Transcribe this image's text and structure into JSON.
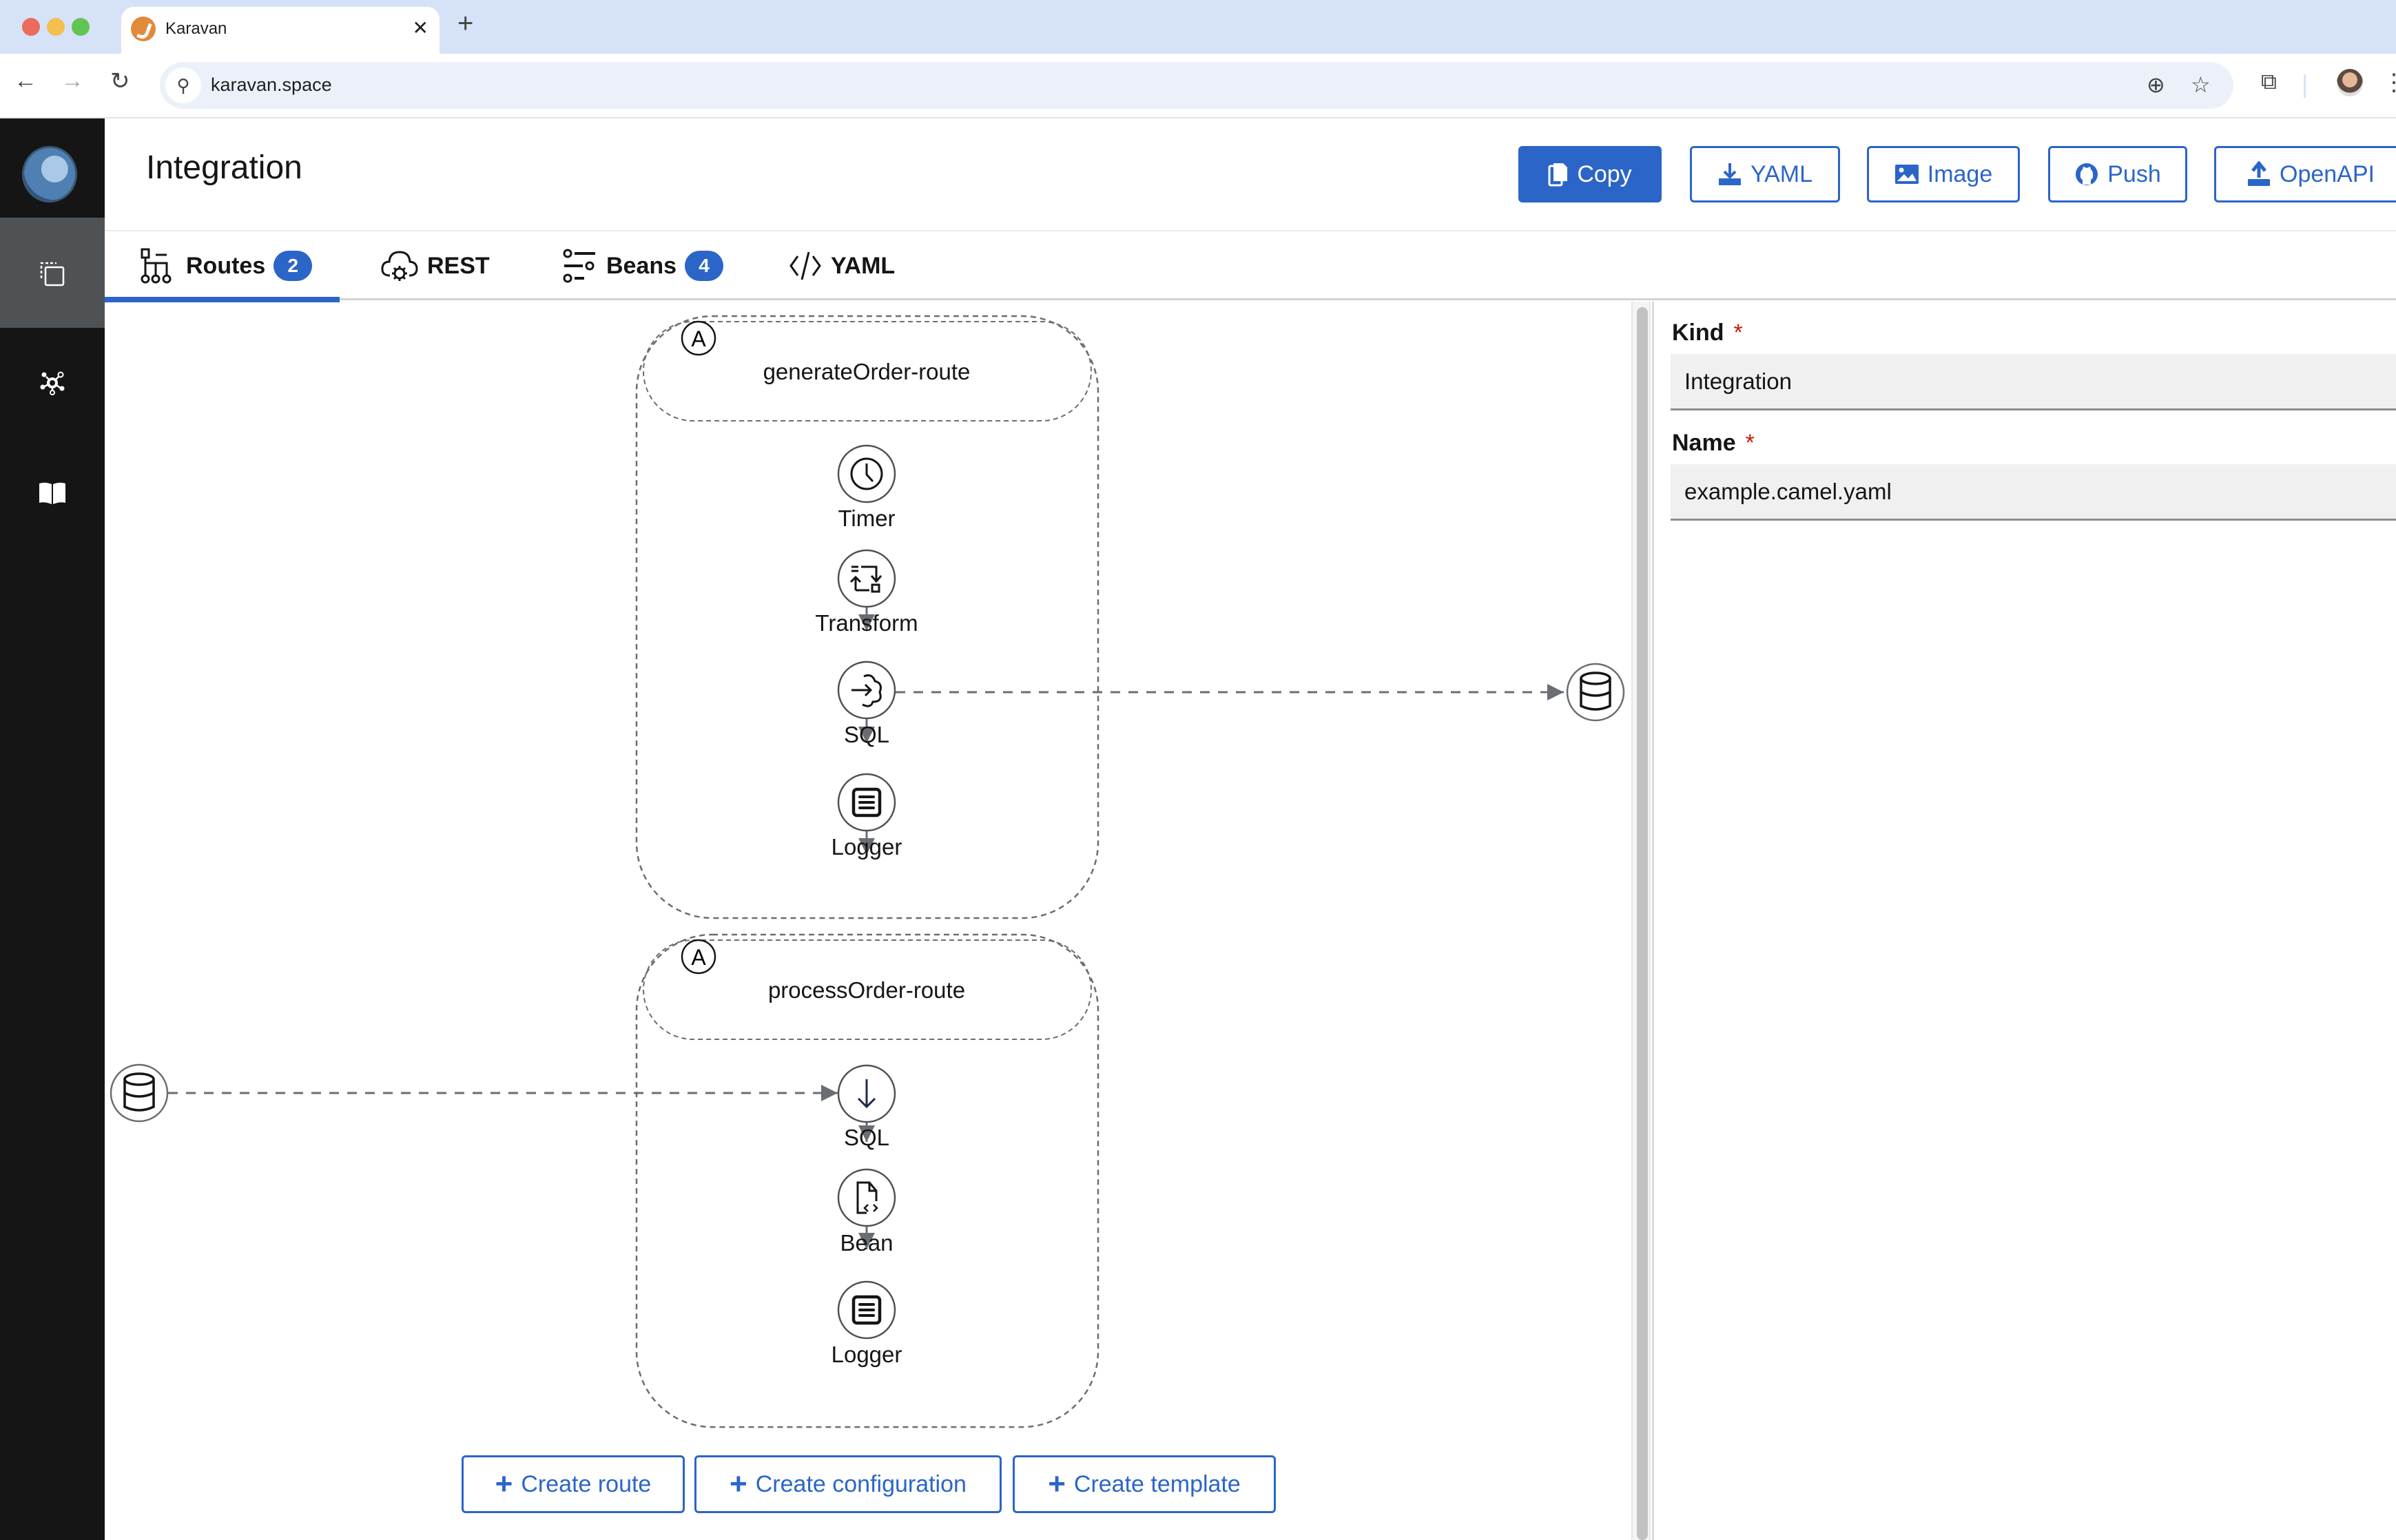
{
  "browser": {
    "tab_title": "Karavan",
    "url": "karavan.space",
    "icons": [
      "back-arrow-icon",
      "forward-arrow-icon",
      "reload-icon",
      "site-info-icon",
      "zoom-icon",
      "bookmark-star-icon",
      "extensions-icon",
      "profile-avatar",
      "menu-icon"
    ]
  },
  "sidebar": {
    "items": [
      {
        "name": "integrations",
        "icon": "copy-dashed-icon",
        "active": true
      },
      {
        "name": "topology",
        "icon": "network-icon",
        "active": false
      },
      {
        "name": "docs",
        "icon": "book-icon",
        "active": false
      }
    ]
  },
  "header": {
    "title": "Integration",
    "buttons": [
      {
        "label": "Copy",
        "icon": "copy-icon",
        "primary": true
      },
      {
        "label": "YAML",
        "icon": "download-icon",
        "primary": false
      },
      {
        "label": "Image",
        "icon": "image-icon",
        "primary": false
      },
      {
        "label": "Push",
        "icon": "github-icon",
        "primary": false
      },
      {
        "label": "OpenAPI",
        "icon": "upload-icon",
        "primary": false
      }
    ]
  },
  "tabs": [
    {
      "label": "Routes",
      "badge": "2",
      "icon": "routes-icon",
      "active": true
    },
    {
      "label": "REST",
      "badge": null,
      "icon": "cloud-gear-icon",
      "active": false
    },
    {
      "label": "Beans",
      "badge": "4",
      "icon": "beans-icon",
      "active": false
    },
    {
      "label": "YAML",
      "badge": null,
      "icon": "code-icon",
      "active": false
    }
  ],
  "routes": [
    {
      "name": "generateOrder-route",
      "autostart_badge": "A",
      "steps": [
        {
          "label": "Timer",
          "icon": "clock-icon"
        },
        {
          "label": "Transform",
          "icon": "transform-icon"
        },
        {
          "label": "SQL",
          "icon": "send-to-icon"
        },
        {
          "label": "Logger",
          "icon": "logger-icon"
        }
      ]
    },
    {
      "name": "processOrder-route",
      "autostart_badge": "A",
      "steps": [
        {
          "label": "SQL",
          "icon": "arrow-down-icon"
        },
        {
          "label": "Bean",
          "icon": "bean-file-icon"
        },
        {
          "label": "Logger",
          "icon": "logger-icon"
        }
      ]
    }
  ],
  "external_nodes": [
    {
      "icon": "database-icon",
      "connects": "generateOrder-route SQL → database"
    },
    {
      "icon": "database-icon",
      "connects": "database → processOrder-route SQL"
    }
  ],
  "actions": {
    "create_route": "Create route",
    "create_configuration": "Create configuration",
    "create_template": "Create template"
  },
  "properties": {
    "kind_label": "Kind",
    "kind_value": "Integration",
    "name_label": "Name",
    "name_value": "example.camel.yaml",
    "required_marker": "*"
  },
  "colors": {
    "accent": "#2b65c8",
    "sidebar_bg": "#151515",
    "sidebar_active": "#4f5255",
    "required": "#c9190b",
    "edge": "#6a6e73"
  }
}
